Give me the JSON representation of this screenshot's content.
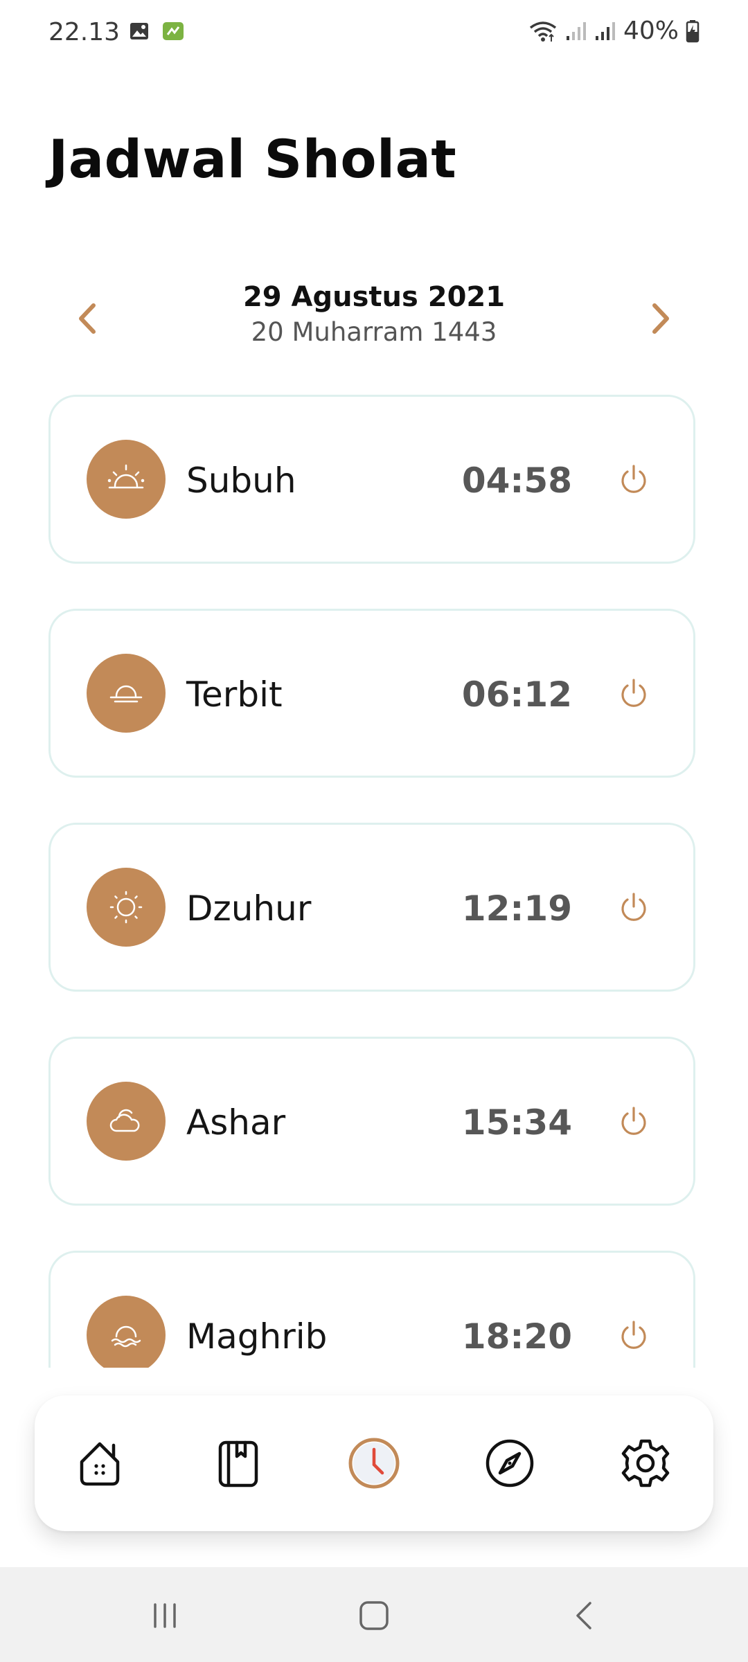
{
  "status_bar": {
    "time": "22.13",
    "battery": "40%",
    "icons": [
      "image-icon",
      "app-notification-icon",
      "wifi-icon",
      "signal-icon",
      "signal-icon",
      "battery-charging-icon"
    ]
  },
  "header": {
    "title": "Jadwal Sholat"
  },
  "date_nav": {
    "gregorian": "29 Agustus 2021",
    "hijri": "20 Muharram 1443",
    "prev_icon": "chevron-left-icon",
    "next_icon": "chevron-right-icon"
  },
  "prayers": [
    {
      "name": "Subuh",
      "time": "04:58",
      "icon": "dawn-icon"
    },
    {
      "name": "Terbit",
      "time": "06:12",
      "icon": "sunrise-icon"
    },
    {
      "name": "Dzuhur",
      "time": "12:19",
      "icon": "sun-icon"
    },
    {
      "name": "Ashar",
      "time": "15:34",
      "icon": "cloud-sun-icon"
    },
    {
      "name": "Maghrib",
      "time": "18:20",
      "icon": "sunset-icon"
    }
  ],
  "bottom_nav": {
    "items": [
      "home-icon",
      "quran-icon",
      "clock-icon",
      "compass-icon",
      "settings-icon"
    ],
    "active": "clock-icon"
  },
  "colors": {
    "accent": "#c28a58",
    "card_border": "#def0ee",
    "time_text": "#575757",
    "clock_hand": "#e04a3a"
  }
}
